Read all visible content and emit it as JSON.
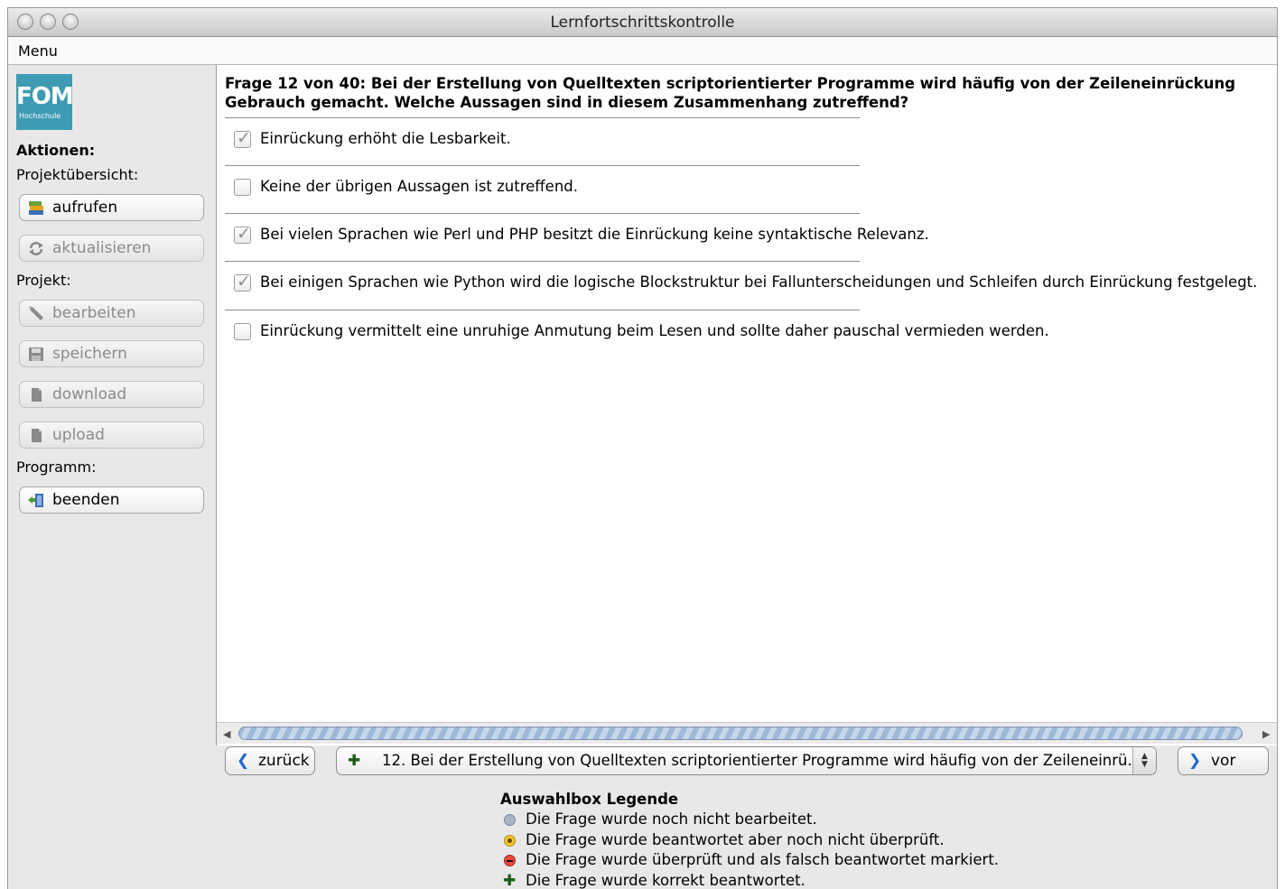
{
  "window": {
    "title": "Lernfortschrittskontrolle"
  },
  "menubar": {
    "menu_label": "Menu"
  },
  "sidebar": {
    "logo_text": "FOM",
    "logo_subtext": "Hochschule",
    "actions_heading": "Aktionen:",
    "project_overview_label": "Projektübersicht:",
    "btn_open": "aufrufen",
    "btn_refresh": "aktualisieren",
    "project_label": "Projekt:",
    "btn_edit": "bearbeiten",
    "btn_save": "speichern",
    "btn_download": "download",
    "btn_upload": "upload",
    "program_label": "Programm:",
    "btn_quit": "beenden"
  },
  "question": {
    "text": "Frage 12 von 40: Bei der Erstellung von Quelltexten scriptorientierter Programme wird häufig von der Zeileneinrückung Gebrauch gemacht. Welche Aussagen sind in diesem Zusammenhang zutreffend?",
    "options": [
      {
        "label": "Einrückung erhöht die Lesbarkeit.",
        "checked": true
      },
      {
        "label": "Keine der übrigen Aussagen ist zutreffend.",
        "checked": false
      },
      {
        "label": "Bei vielen Sprachen wie Perl und PHP besitzt die Einrückung keine syntaktische Relevanz.",
        "checked": true
      },
      {
        "label": "Bei einigen Sprachen wie Python wird die logische Blockstruktur bei Fallunterscheidungen und Schleifen durch Einrückung festgelegt.",
        "checked": true
      },
      {
        "label": "Einrückung vermittelt eine unruhige Anmutung beim Lesen und sollte daher pauschal vermieden werden.",
        "checked": false
      }
    ]
  },
  "navigation": {
    "back_label": "zurück",
    "next_label": "vor",
    "selector_text": "12. Bei der Erstellung von Quelltexten scriptorientierter Programme wird häufig von der Zeileneinrü..."
  },
  "legend": {
    "title": "Auswahlbox Legende",
    "items": [
      {
        "icon": "grey-dot-icon",
        "text": "Die Frage wurde noch nicht bearbeitet."
      },
      {
        "icon": "yellow-dot-icon",
        "text": "Die Frage wurde beantwortet aber noch nicht überprüft."
      },
      {
        "icon": "red-minus-icon",
        "text": "Die Frage wurde überprüft und als falsch beantwortet markiert."
      },
      {
        "icon": "green-plus-icon",
        "text": "Die Frage wurde korrekt beantwortet."
      }
    ]
  },
  "colors": {
    "accent": "#1f66d3",
    "logo": "#3e9bb3",
    "correct": "#1a5d1a"
  }
}
